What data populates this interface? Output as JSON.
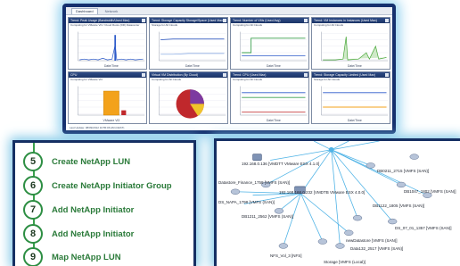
{
  "dashboard": {
    "tabs": [
      "Dashboard",
      "Network"
    ],
    "widgets": [
      {
        "title": "Trend: Peak Usage (Bandwidth/Used Max)",
        "subtitle": "Computing for VMware Vi3 / Cloud Roots (DR) Datacenter",
        "type": "spike",
        "color": "#2b59c9",
        "xlabel": "Date/Time"
      },
      {
        "title": "Trend: Storage Capacity Storage/Space (Used Max)",
        "subtitle": "Storage for All Clouds",
        "type": "flat-line",
        "color": "#3a62c4",
        "xlabel": "Date/Time"
      },
      {
        "title": "Trend: Number of VMs (Used Avg)",
        "subtitle": "Computing for All Clouds",
        "type": "two-lines",
        "color": "#3aa04d",
        "xlabel": "Date/Time"
      },
      {
        "title": "Trend: VM Instances in Instances (Used Max)",
        "subtitle": "Computing for All Clouds",
        "type": "green-bars",
        "color": "#4aa83a",
        "xlabel": "Date/Time"
      },
      {
        "title": "CPU",
        "subtitle": "Computing for VMware Vi3",
        "type": "bar-chart",
        "color": "#f3a21b",
        "xlabel": "VMware Vi3"
      },
      {
        "title": "Virtual VM Distribution (By Cloud)",
        "subtitle": "Computing for All Clouds",
        "type": "pie",
        "color": "#c0282c",
        "xlabel": ""
      },
      {
        "title": "Trend: CPU (Used Max)",
        "subtitle": "Computing for All Clouds",
        "type": "flat-multi",
        "color": "#3aa04d",
        "xlabel": "Date/Time"
      },
      {
        "title": "Trend: Storage Capacity Limited (Used Max)",
        "subtitle": "Storage for All Clouds",
        "type": "flat-multi2",
        "color": "#f3a21b",
        "xlabel": "Date/Time"
      }
    ],
    "footer": "Last Update: 08/09/2012 10:55:06 AM (CEST)"
  },
  "steps": [
    {
      "num": "5",
      "label": "Create NetApp LUN"
    },
    {
      "num": "6",
      "label": "Create NetApp Initiator Group"
    },
    {
      "num": "7",
      "label": "Add NetApp Initiator"
    },
    {
      "num": "8",
      "label": "Add NetApp Initiator"
    },
    {
      "num": "9",
      "label": "Map NetApp LUN"
    }
  ],
  "topology": {
    "labels": [
      "192.168.0.136 [VMDTT VMware ESX 4.1.0]",
      "Datastore_Finance_1758 [VMFS (SAN)]",
      "DS_NAPA_1798 [VMFS (SAN)]",
      "DB1211_2562 [VMFS (SAN)]",
      "192.168.168.0.232 [VMDTB VMware ESX 4.0.0]",
      "DB0211_2715 [VMFS (SAN)]",
      "DB1047_1802 [VMFS (SAN)]",
      "DB1122_1805 [VMFS (SAN)]",
      "DS_07_01_1357 [VMFS (SAN)]",
      "newDatastore [VMFS (SAN)]",
      "Data132_2517 [VMFS (SAN)]",
      "NFS_Vol_3 [NFS]",
      "Storage [VMFS (Local)]"
    ]
  }
}
